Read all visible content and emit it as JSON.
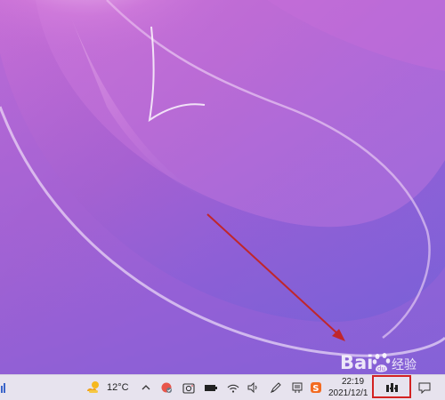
{
  "desktop": {
    "wallpaper": "purple-pink abstract swirl",
    "annotation_arrow_color": "#c0262b"
  },
  "taskbar": {
    "left_icon": "start-edge-icon",
    "weather": {
      "icon": "weather-sun-icon",
      "temperature": "12°C"
    },
    "tray_icons": [
      "chevron-up-icon",
      "security-shield-icon",
      "camera-app-icon",
      "battery-icon",
      "wifi-icon",
      "volume-icon",
      "pen-icon",
      "input-method-icon",
      "sogou-input-icon"
    ],
    "clock": {
      "time": "22:19",
      "date": "2021/12/1"
    },
    "show_desktop": "show-desktop-icon",
    "notifications": "notification-icon"
  },
  "watermark": {
    "text": "Bai",
    "paw": "du",
    "suffix": "经验"
  },
  "colors": {
    "taskbar_bg": "#e7e3ee",
    "highlight_red": "#d32222",
    "arrow_red": "#c0262b"
  }
}
